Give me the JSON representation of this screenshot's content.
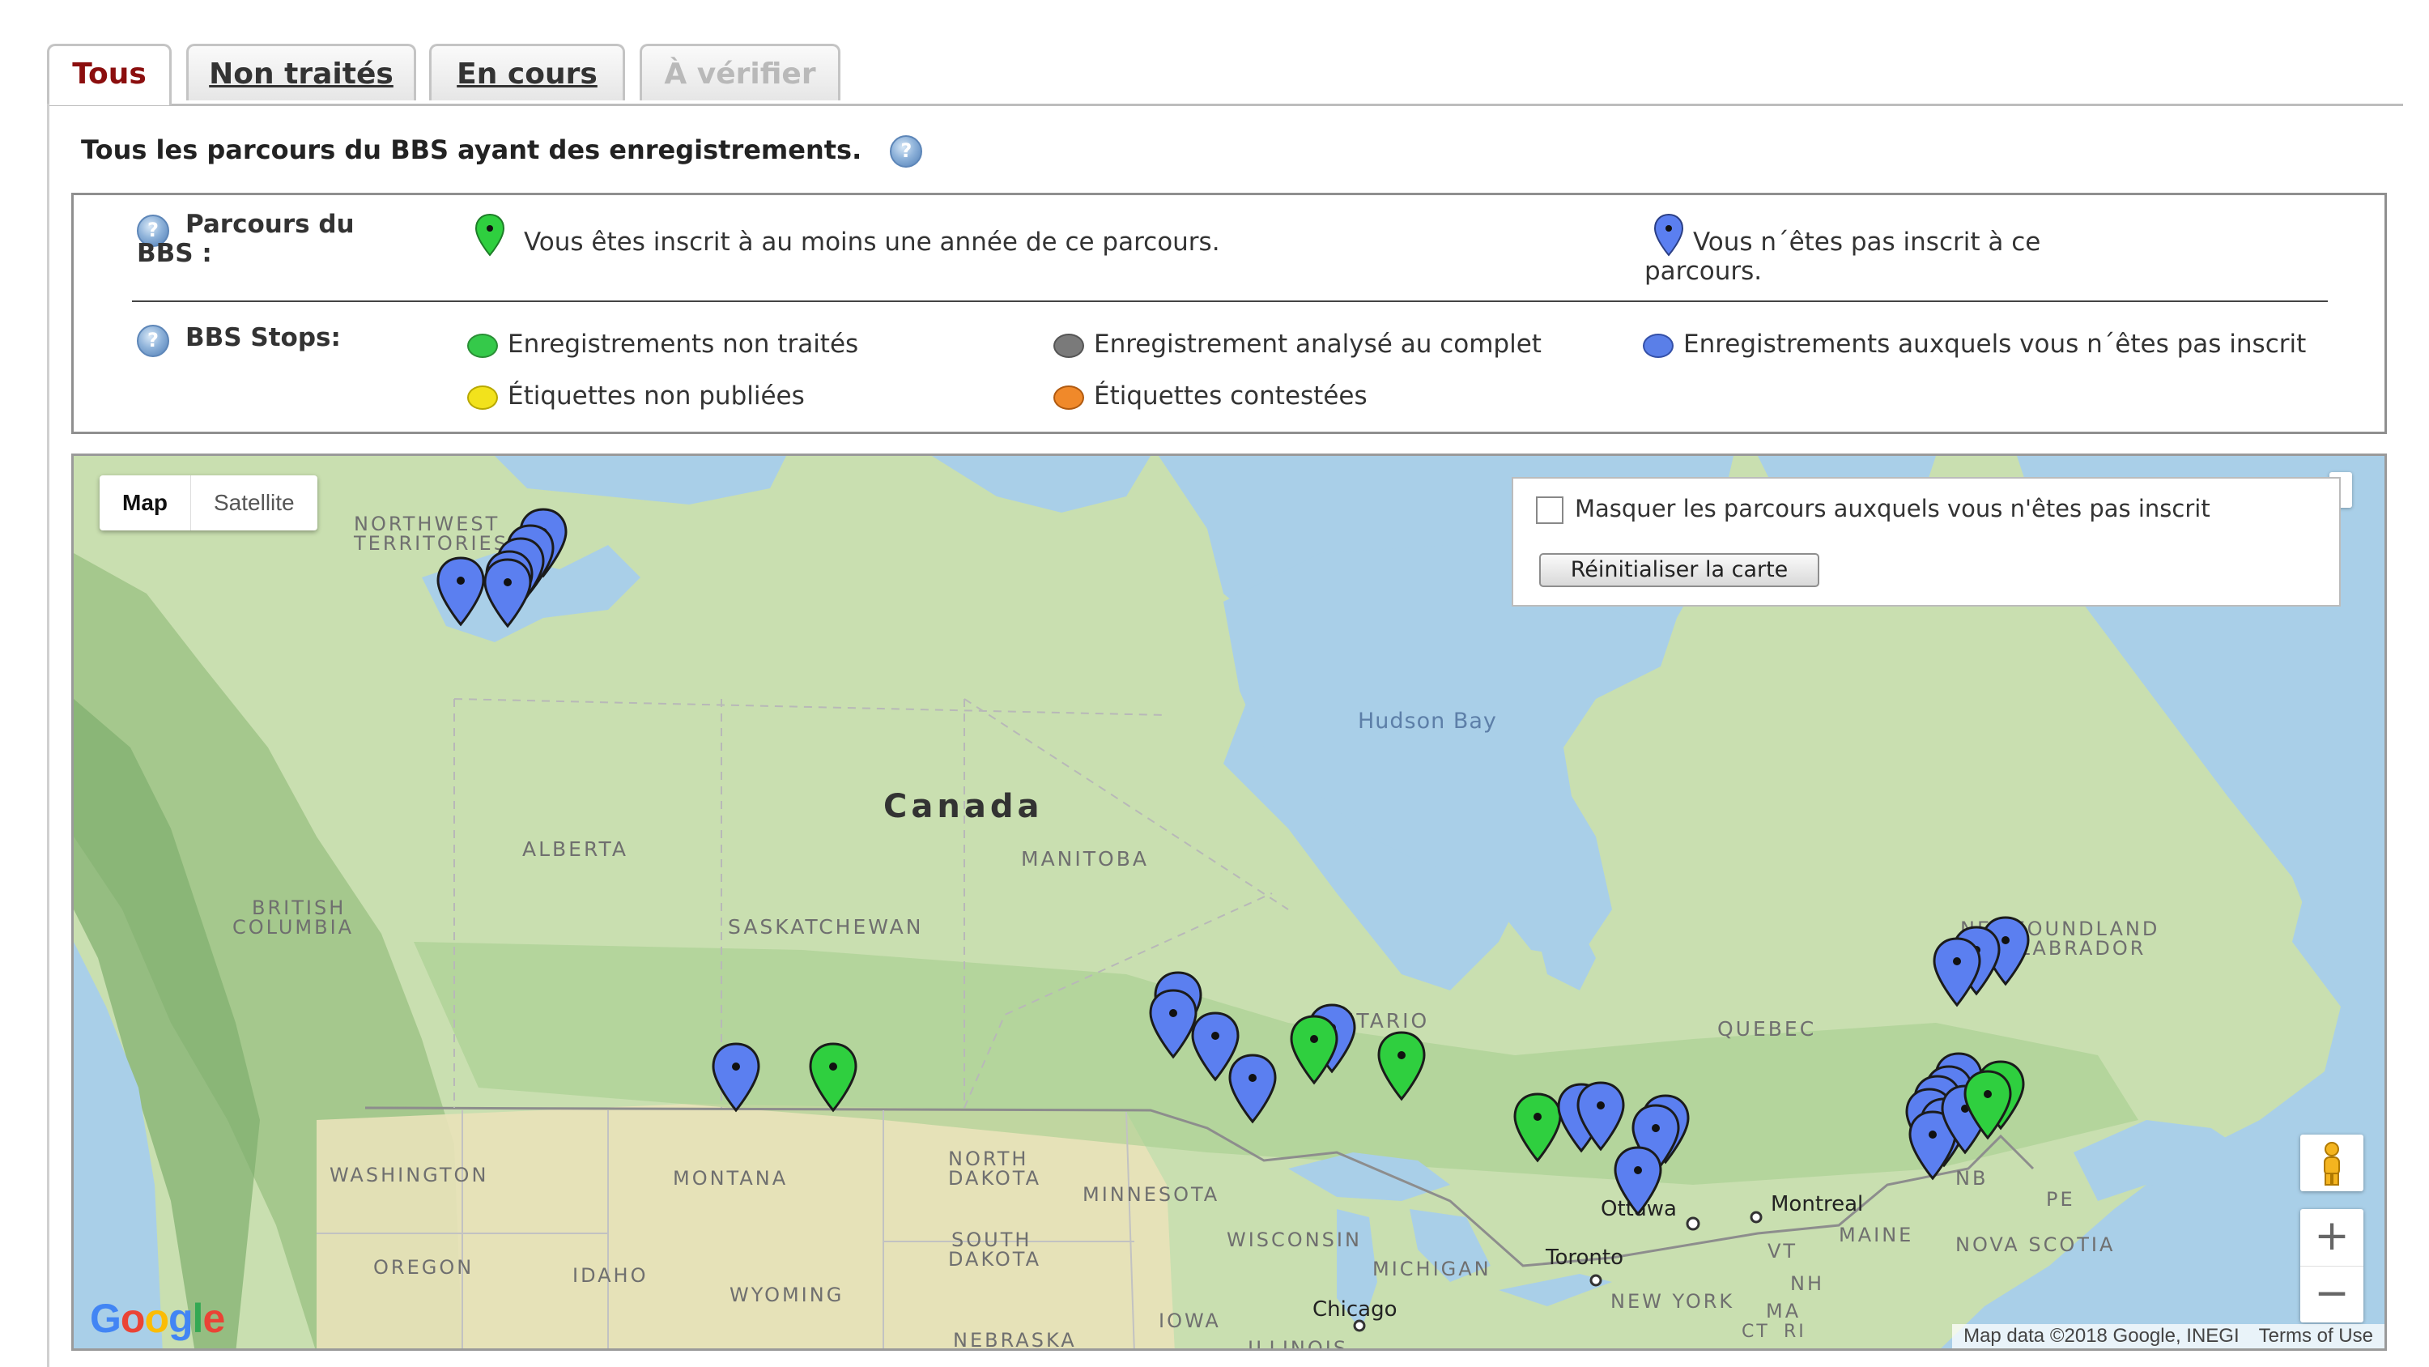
{
  "tabs": [
    {
      "label": "Tous",
      "state": "active"
    },
    {
      "label": "Non traités",
      "state": "normal"
    },
    {
      "label": "En cours",
      "state": "normal"
    },
    {
      "label": "À vérifier",
      "state": "disabled"
    }
  ],
  "intro_text": "Tous les parcours du BBS ayant des enregistrements.",
  "legend": {
    "routes_heading": "Parcours du BBS :",
    "route_enrolled": "Vous êtes inscrit à au moins une année de ce parcours.",
    "route_not_enrolled": "Vous n´êtes pas inscrit à ce parcours.",
    "stops_heading": "BBS Stops:",
    "stops": [
      {
        "label": "Enregistrements non traités",
        "color": "#35c94a"
      },
      {
        "label": "Enregistrement analysé au complet",
        "color": "#7a7a7a"
      },
      {
        "label": "Enregistrements auxquels vous n´êtes pas inscrit",
        "color": "#5a7fe8"
      },
      {
        "label": "Étiquettes non publiées",
        "color": "#f2e21c"
      },
      {
        "label": "Étiquettes contestées",
        "color": "#f0892a"
      }
    ]
  },
  "map": {
    "type_buttons": {
      "map": "Map",
      "satellite": "Satellite"
    },
    "hide_checkbox_label": "Masquer les parcours auxquels vous n'êtes pas inscrit",
    "hide_checkbox_checked": false,
    "reset_button": "Réinitialiser la carte",
    "zoom_in": "+",
    "zoom_out": "−",
    "google_logo": "Google",
    "attribution": "Map data ©2018 Google, INEGI",
    "terms": "Terms of Use",
    "labels": {
      "canada": "Canada",
      "hudson_bay": "Hudson Bay",
      "nwt_1": "NORTHWEST",
      "nwt_2": "TERRITORIES",
      "alberta": "ALBERTA",
      "manitoba": "MANITOBA",
      "bc_1": "BRITISH",
      "bc_2": "COLUMBIA",
      "saskatchewan": "SASKATCHEWAN",
      "ontario": "ONTARIO",
      "quebec": "QUEBEC",
      "nl_1": "NEWFOUNDLAND",
      "nl_2": "AND LABRADOR",
      "washington": "WASHINGTON",
      "montana": "MONTANA",
      "north_dakota_1": "NORTH",
      "north_dakota_2": "DAKOTA",
      "minnesota": "MINNESOTA",
      "south_dakota_1": "SOUTH",
      "south_dakota_2": "DAKOTA",
      "oregon": "OREGON",
      "idaho": "IDAHO",
      "wyoming": "WYOMING",
      "wisconsin": "WISCONSIN",
      "michigan": "MICHIGAN",
      "iowa": "IOWA",
      "nebraska": "NEBRASKA",
      "illinois": "ILLINOIS",
      "nb": "NB",
      "pe": "PE",
      "nova_scotia": "NOVA SCOTIA",
      "maine": "MAINE",
      "vt": "VT",
      "nh": "NH",
      "ma": "MA",
      "ct": "CT",
      "ri": "RI",
      "new_york": "NEW YORK",
      "ottawa": "Ottawa",
      "montreal": "Montreal",
      "toronto": "Toronto",
      "chicago": "Chicago"
    },
    "markers": [
      {
        "status": "enrolled",
        "color": "#2fcf3f",
        "count": 8
      },
      {
        "status": "not_enrolled",
        "color": "#5b7ff0",
        "count": 29
      }
    ]
  }
}
